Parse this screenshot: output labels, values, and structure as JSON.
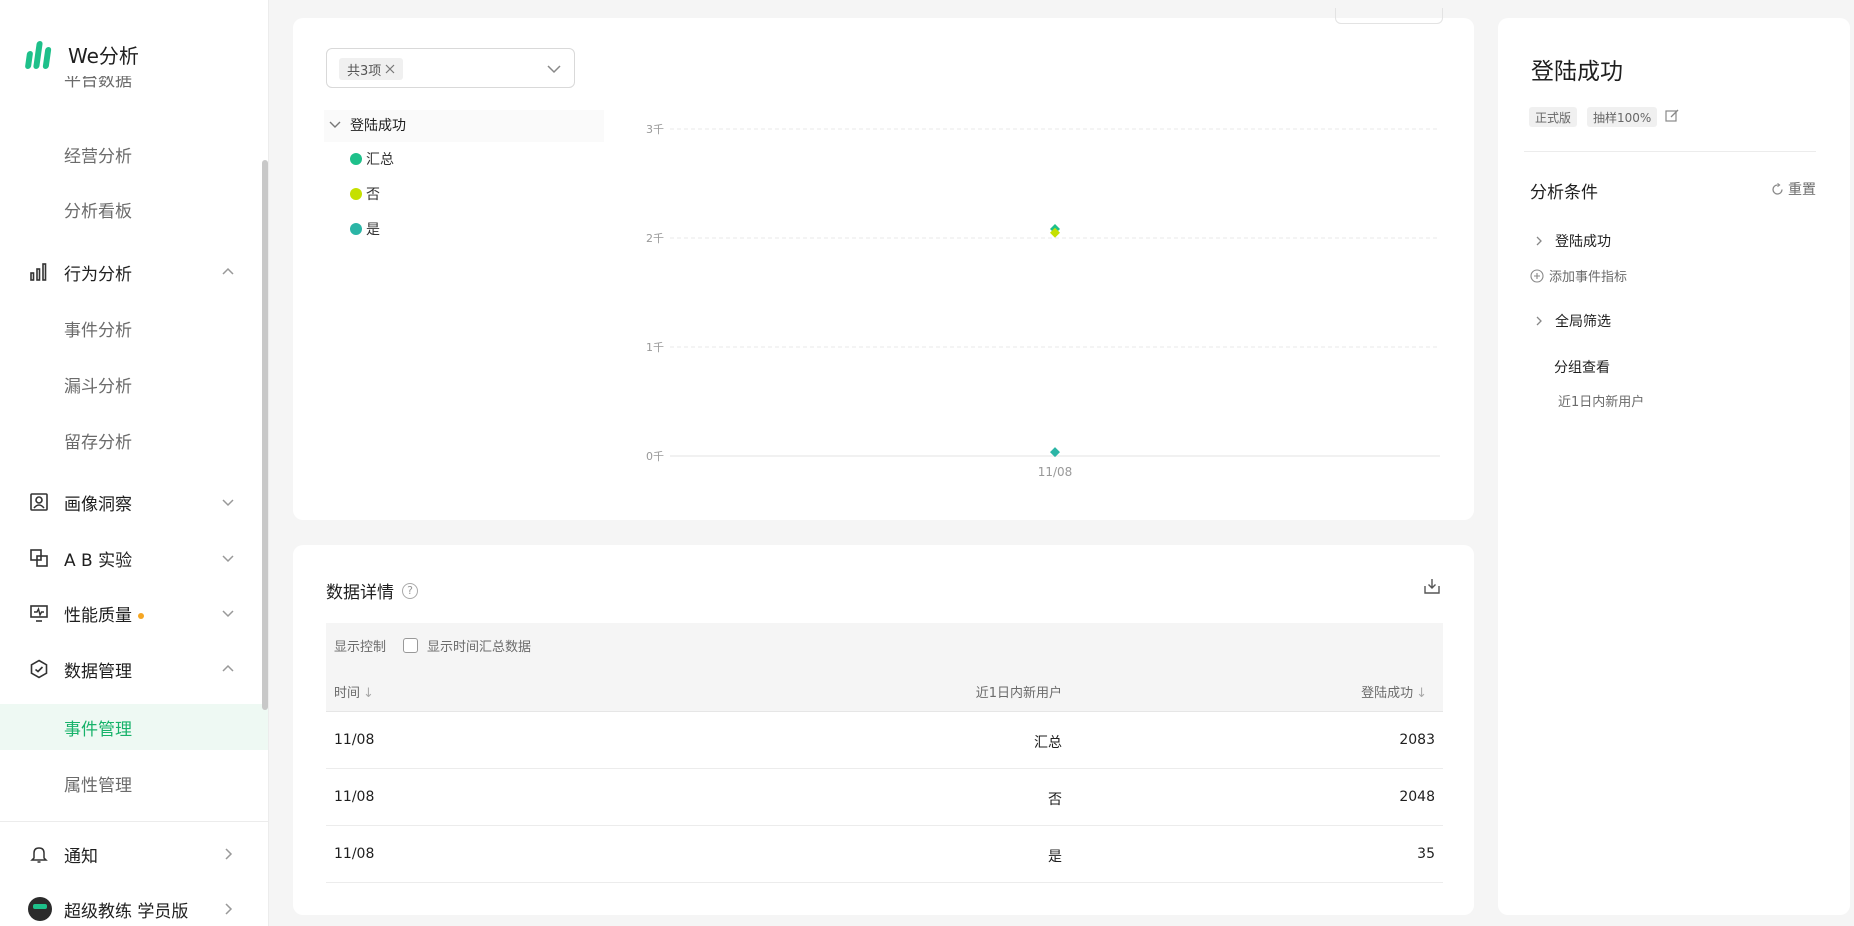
{
  "app": {
    "name": "We分析"
  },
  "sidebar": {
    "truncated_item": "平台数据",
    "items": [
      {
        "label": "经营分析"
      },
      {
        "label": "分析看板"
      },
      {
        "label": "行为分析"
      },
      {
        "label": "事件分析"
      },
      {
        "label": "漏斗分析"
      },
      {
        "label": "留存分析"
      },
      {
        "label": "画像洞察"
      },
      {
        "label": "A B 实验"
      },
      {
        "label": "性能质量"
      },
      {
        "label": "数据管理"
      },
      {
        "label": "事件管理"
      },
      {
        "label": "属性管理"
      },
      {
        "label": "通知"
      },
      {
        "label": "超级教练 学员版"
      }
    ]
  },
  "filter": {
    "tag_label": "共3项",
    "event_name": "登陆成功",
    "legend": [
      {
        "label": "汇总",
        "color": "#1ec08a"
      },
      {
        "label": "否",
        "color": "#c5e000"
      },
      {
        "label": "是",
        "color": "#2bb5a6"
      }
    ]
  },
  "chart_data": {
    "type": "scatter",
    "categories": [
      "11/08"
    ],
    "y_ticks": [
      "3千",
      "2千",
      "1千",
      "0千"
    ],
    "ylim": [
      0,
      3000
    ],
    "grid": true,
    "series": [
      {
        "name": "汇总",
        "values": [
          2083
        ],
        "color": "#1ec08a"
      },
      {
        "name": "否",
        "values": [
          2048
        ],
        "color": "#c5e000"
      },
      {
        "name": "是",
        "values": [
          35
        ],
        "color": "#2bb5a6"
      }
    ]
  },
  "table": {
    "title": "数据详情",
    "help_symbol": "?",
    "control_label": "显示控制",
    "checkbox_label": "显示时间汇总数据",
    "columns": [
      "时间",
      "近1日内新用户",
      "登陆成功"
    ],
    "sort_symbol": "↓",
    "rows": [
      [
        "11/08",
        "汇总",
        "2083"
      ],
      [
        "11/08",
        "否",
        "2048"
      ],
      [
        "11/08",
        "是",
        "35"
      ]
    ]
  },
  "right_panel": {
    "title": "登陆成功",
    "badges": [
      "正式版",
      "抽样100%"
    ],
    "section_title": "分析条件",
    "reset_label": "重置",
    "event_row": "登陆成功",
    "add_metric": "添加事件指标",
    "global_filter": "全局筛选",
    "group_view": "分组查看",
    "group_value": "近1日内新用户"
  }
}
